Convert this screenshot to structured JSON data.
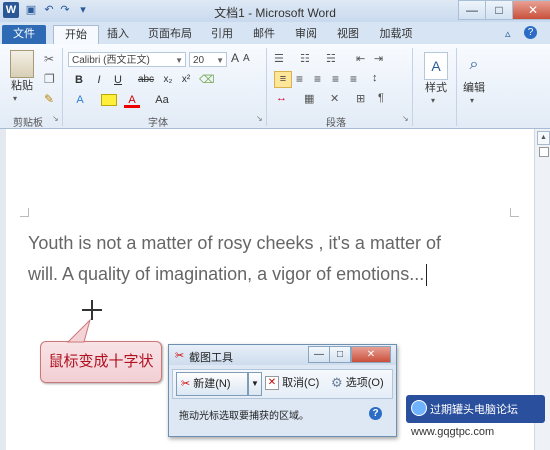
{
  "window": {
    "title": "文档1 - Microsoft Word",
    "logo_letter": "W",
    "controls": [
      "—",
      "□",
      "✕"
    ]
  },
  "tabs": [
    {
      "label": "文件"
    },
    {
      "label": "开始"
    },
    {
      "label": "插入"
    },
    {
      "label": "页面布局"
    },
    {
      "label": "引用"
    },
    {
      "label": "邮件"
    },
    {
      "label": "审阅"
    },
    {
      "label": "视图"
    },
    {
      "label": "加载项"
    }
  ],
  "ribbon": {
    "clipboard": {
      "paste_label": "粘贴",
      "group_label": "剪贴板"
    },
    "font": {
      "font_name": "Calibri (西文正文)",
      "font_size": "20",
      "group_label": "字体",
      "buttons": [
        "B",
        "I",
        "U",
        "abc",
        "x₂",
        "x²",
        "A",
        "A",
        "Aa"
      ]
    },
    "paragraph": {
      "group_label": "段落"
    },
    "styles": {
      "label": "样式"
    },
    "editing": {
      "label": "编辑"
    }
  },
  "document": {
    "line1": "Youth is not a matter  of rosy cheeks , it's a matter of",
    "line2": "will. A quality of imagination, a vigor of emotions..."
  },
  "callout": {
    "text": "鼠标变成十字状"
  },
  "snipping_tool": {
    "title": "截图工具",
    "new_label": "新建(N)",
    "cancel_label": "取消(C)",
    "options_label": "选项(O)",
    "status": "拖动光标选取要捕获的区域。",
    "help": "?"
  },
  "watermark": {
    "name": "过期罐头电脑论坛",
    "url": "www.gqgtpc.com"
  }
}
